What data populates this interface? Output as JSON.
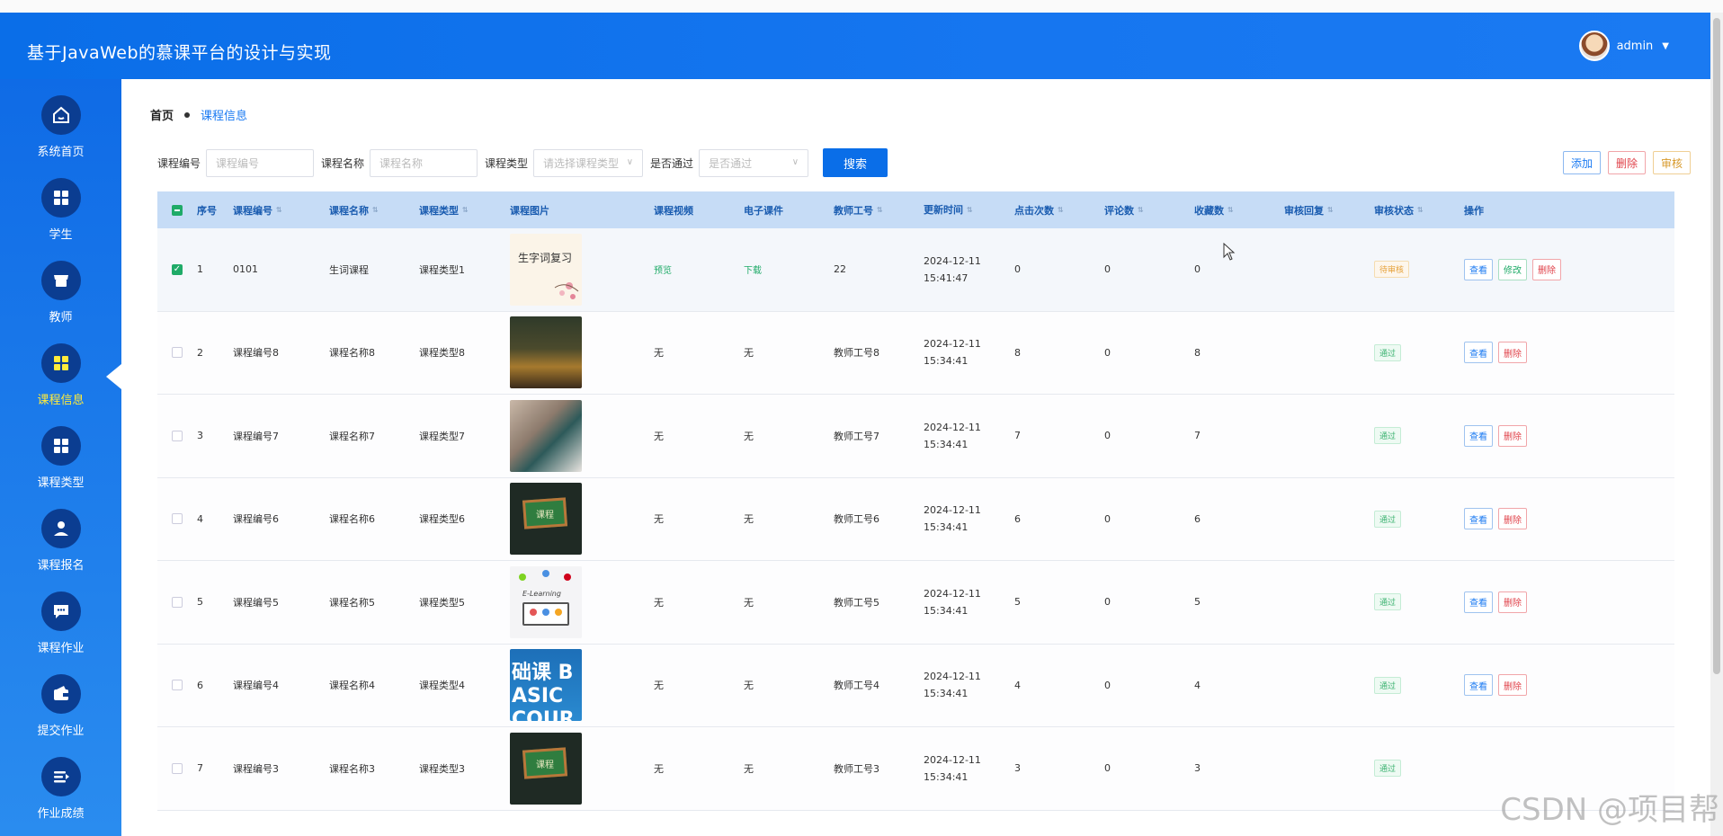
{
  "app": {
    "title": "基于JavaWeb的慕课平台的设计与实现",
    "user": "admin"
  },
  "sidebar": {
    "items": [
      {
        "label": "系统首页",
        "icon": "home-icon"
      },
      {
        "label": "学生",
        "icon": "grid-icon"
      },
      {
        "label": "教师",
        "icon": "store-icon"
      },
      {
        "label": "课程信息",
        "icon": "grid-icon",
        "active": true
      },
      {
        "label": "课程类型",
        "icon": "grid-icon"
      },
      {
        "label": "课程报名",
        "icon": "person-icon"
      },
      {
        "label": "课程作业",
        "icon": "chat-icon"
      },
      {
        "label": "提交作业",
        "icon": "wallet-icon"
      },
      {
        "label": "作业成绩",
        "icon": "list-icon"
      }
    ]
  },
  "breadcrumb": {
    "home": "首页",
    "current": "课程信息"
  },
  "search": {
    "code_label": "课程编号",
    "code_placeholder": "课程编号",
    "name_label": "课程名称",
    "name_placeholder": "课程名称",
    "type_label": "课程类型",
    "type_placeholder": "请选择课程类型",
    "pass_label": "是否通过",
    "pass_placeholder": "是否通过",
    "search_button": "搜索"
  },
  "toolbar": {
    "add": "添加",
    "delete": "删除",
    "audit": "审核"
  },
  "table": {
    "headers": [
      "序号",
      "课程编号",
      "课程名称",
      "课程类型",
      "课程图片",
      "课程视频",
      "电子课件",
      "教师工号",
      "更新时间",
      "点击次数",
      "评论数",
      "收藏数",
      "审核回复",
      "审核状态",
      "操作"
    ],
    "rows": [
      {
        "idx": "1",
        "code": "0101",
        "name": "生词课程",
        "type": "课程类型1",
        "img_text": "生字词复习",
        "video": "预览",
        "ware": "下载",
        "teacher": "22",
        "time": "2024-12-11 15:41:47",
        "click": "0",
        "comments": "0",
        "fav": "0",
        "reply": "",
        "state": "待审核",
        "checked": true
      },
      {
        "idx": "2",
        "code": "课程编号8",
        "name": "课程名称8",
        "type": "课程类型8",
        "img_text": "",
        "video": "无",
        "ware": "无",
        "teacher": "教师工号8",
        "time": "2024-12-11 15:34:41",
        "click": "8",
        "comments": "0",
        "fav": "8",
        "reply": "",
        "state": "通过"
      },
      {
        "idx": "3",
        "code": "课程编号7",
        "name": "课程名称7",
        "type": "课程类型7",
        "img_text": "",
        "video": "无",
        "ware": "无",
        "teacher": "教师工号7",
        "time": "2024-12-11 15:34:41",
        "click": "7",
        "comments": "0",
        "fav": "7",
        "reply": "",
        "state": "通过"
      },
      {
        "idx": "4",
        "code": "课程编号6",
        "name": "课程名称6",
        "type": "课程类型6",
        "img_text": "课程",
        "video": "无",
        "ware": "无",
        "teacher": "教师工号6",
        "time": "2024-12-11 15:34:41",
        "click": "6",
        "comments": "0",
        "fav": "6",
        "reply": "",
        "state": "通过"
      },
      {
        "idx": "5",
        "code": "课程编号5",
        "name": "课程名称5",
        "type": "课程类型5",
        "img_text": "E-Learning",
        "video": "无",
        "ware": "无",
        "teacher": "教师工号5",
        "time": "2024-12-11 15:34:41",
        "click": "5",
        "comments": "0",
        "fav": "5",
        "reply": "",
        "state": "通过"
      },
      {
        "idx": "6",
        "code": "课程编号4",
        "name": "课程名称4",
        "type": "课程类型4",
        "img_text": "础课 BASIC COURSE",
        "video": "无",
        "ware": "无",
        "teacher": "教师工号4",
        "time": "2024-12-11 15:34:41",
        "click": "4",
        "comments": "0",
        "fav": "4",
        "reply": "",
        "state": "通过"
      },
      {
        "idx": "7",
        "code": "课程编号3",
        "name": "课程名称3",
        "type": "课程类型3",
        "img_text": "课程",
        "video": "无",
        "ware": "无",
        "teacher": "教师工号3",
        "time": "2024-12-11 15:34:41",
        "click": "3",
        "comments": "0",
        "fav": "3",
        "reply": "",
        "state": "通过"
      }
    ],
    "row_actions": {
      "view": "查看",
      "edit": "修改",
      "delete": "删除"
    }
  },
  "watermark": "CSDN @项目帮"
}
